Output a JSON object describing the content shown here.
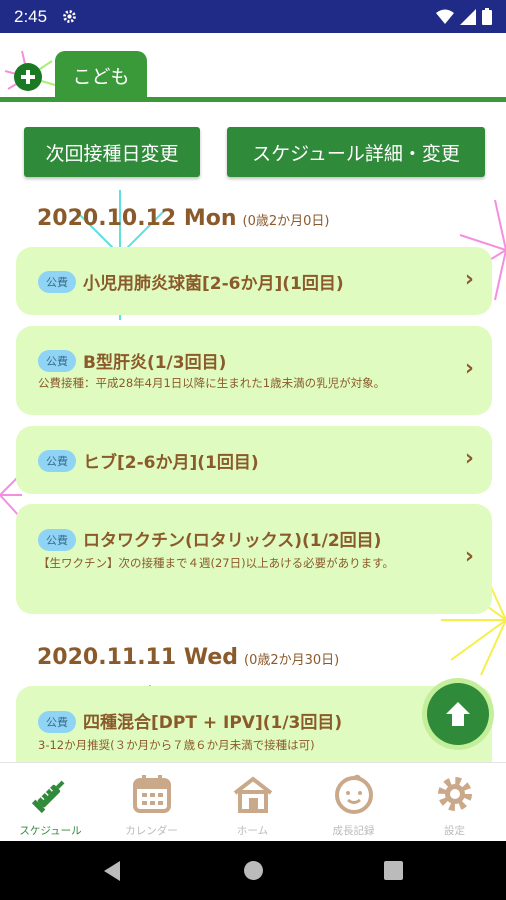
{
  "status_bar": {
    "time": "2:45"
  },
  "header": {
    "active_tab": "こども"
  },
  "actions": {
    "next_date_label": "次回接種日変更",
    "schedule_label": "スケジュール詳細・変更"
  },
  "groups": [
    {
      "date": "2020.10.12 Mon",
      "age": "(0歳2か月0日)",
      "cards": [
        {
          "badge": "公費",
          "title": "小児用肺炎球菌[2-6か月](1回目)",
          "desc": ""
        },
        {
          "badge": "公費",
          "title": "B型肝炎(1/3回目)",
          "desc": "公費接種：平成28年4月1日以降に生まれた1歳未満の乳児が対象。"
        },
        {
          "badge": "公費",
          "title": "ヒブ[2-6か月](1回目)",
          "desc": ""
        },
        {
          "badge": "公費",
          "title": "ロタワクチン(ロタリックス)(1/2回目)",
          "desc": "【生ワクチン】次の接種まで４週(27日)以上あける必要があります。"
        }
      ]
    },
    {
      "date": "2020.11.11 Wed",
      "age": "(0歳2か月30日)",
      "cards": [
        {
          "badge": "公費",
          "title": "四種混合[DPT + IPV](1/3回目)",
          "desc": "3-12か月推奨(３か月から７歳６か月未満で接種は可)"
        }
      ]
    }
  ],
  "bottom_nav": [
    {
      "label": "スケジュール",
      "icon": "syringe-icon",
      "active": true
    },
    {
      "label": "カレンダー",
      "icon": "calendar-icon",
      "active": false
    },
    {
      "label": "ホーム",
      "icon": "home-icon",
      "active": false
    },
    {
      "label": "成長記録",
      "icon": "baby-face-icon",
      "active": false
    },
    {
      "label": "設定",
      "icon": "gear-icon",
      "active": false
    }
  ],
  "colors": {
    "primary_green": "#2f8a3a",
    "card_bg": "#e0fbc0",
    "brown_text": "#8b5a2b",
    "badge_blue": "#8fd3f5",
    "status_bar": "#1f2b86"
  }
}
